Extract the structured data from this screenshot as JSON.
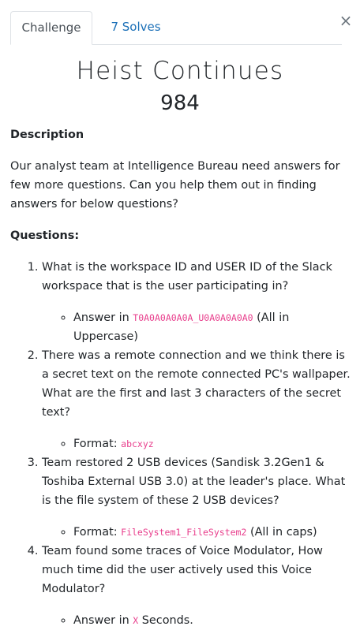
{
  "tabs": [
    {
      "label": "Challenge"
    },
    {
      "label": "7 Solves"
    }
  ],
  "close_glyph": "×",
  "challenge": {
    "title": "Heist Continues",
    "points": "984"
  },
  "description": {
    "heading": "Description",
    "text": "Our analyst team at Intelligence Bureau need answers for few more questions. Can you help them out in finding answers for below questions?"
  },
  "questions": {
    "heading": "Questions:",
    "items": [
      {
        "text": "What is the workspace ID and USER ID of the Slack workspace that is the user participating in?",
        "sub_prefix": "Answer in ",
        "sub_code": "T0A0A0A0A0A_U0A0A0A0A0",
        "sub_suffix": " (All in Uppercase)"
      },
      {
        "text": "There was a remote connection and we think there is a secret text on the remote connected PC's wallpaper. What are the first and last 3 characters of the secret text?",
        "sub_prefix": "Format: ",
        "sub_code": "abcxyz",
        "sub_suffix": ""
      },
      {
        "text": "Team restored 2 USB devices (Sandisk 3.2Gen1 & Toshiba External USB 3.0) at the leader's place. What is the file system of these 2 USB devices?",
        "sub_prefix": "Format: ",
        "sub_code": "FileSystem1_FileSystem2",
        "sub_suffix": " (All in caps)"
      },
      {
        "text": "Team found some traces of Voice Modulator, How much time did the user actively used this Voice Modulator?",
        "sub_prefix": "Answer in ",
        "sub_code": "X",
        "sub_suffix": " Seconds."
      }
    ]
  },
  "colors": {
    "link": "#1a6fb7",
    "code": "#e83e8c",
    "text": "#212529"
  }
}
